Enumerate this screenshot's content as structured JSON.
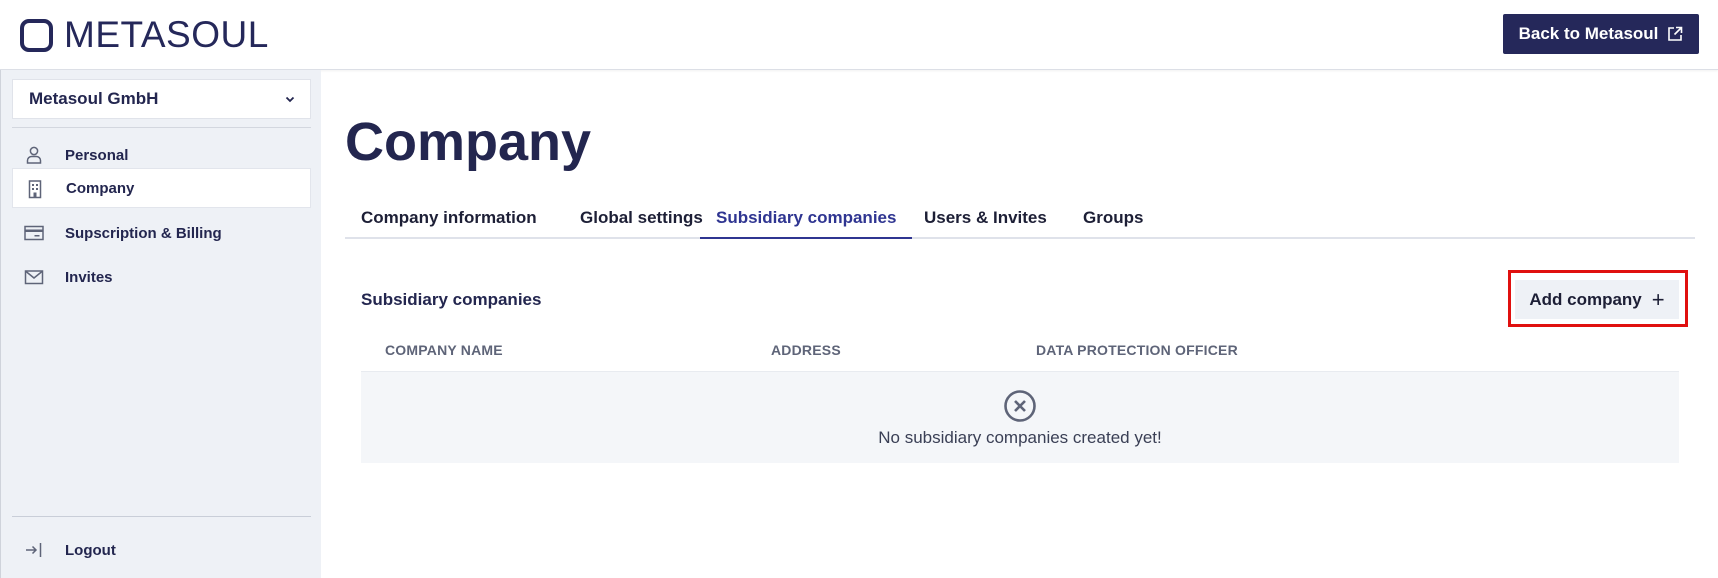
{
  "header": {
    "logo_text": "METASOUL",
    "back_button_label": "Back to Metasoul"
  },
  "sidebar": {
    "company_select_value": "Metasoul GmbH",
    "items": [
      {
        "label": "Personal",
        "icon": "person-icon",
        "active": false
      },
      {
        "label": "Company",
        "icon": "building-icon",
        "active": true
      },
      {
        "label": "Supscription & Billing",
        "icon": "credit-card-icon",
        "active": false
      },
      {
        "label": "Invites",
        "icon": "envelope-icon",
        "active": false
      }
    ],
    "logout_label": "Logout"
  },
  "main": {
    "title": "Company",
    "tabs": [
      {
        "label": "Company information",
        "active": false
      },
      {
        "label": "Global settings",
        "active": false
      },
      {
        "label": "Subsidiary companies",
        "active": true
      },
      {
        "label": "Users & Invites",
        "active": false
      },
      {
        "label": "Groups",
        "active": false
      }
    ],
    "section_title": "Subsidiary companies",
    "add_button_label": "Add company",
    "table": {
      "columns": [
        "COMPANY NAME",
        "ADDRESS",
        "DATA PROTECTION OFFICER"
      ],
      "empty_message": "No subsidiary companies created yet!"
    }
  },
  "colors": {
    "brand": "#25285a",
    "active_tab": "#2f3591",
    "sidebar_bg": "#eef1f6",
    "highlight": "#e0100f"
  }
}
